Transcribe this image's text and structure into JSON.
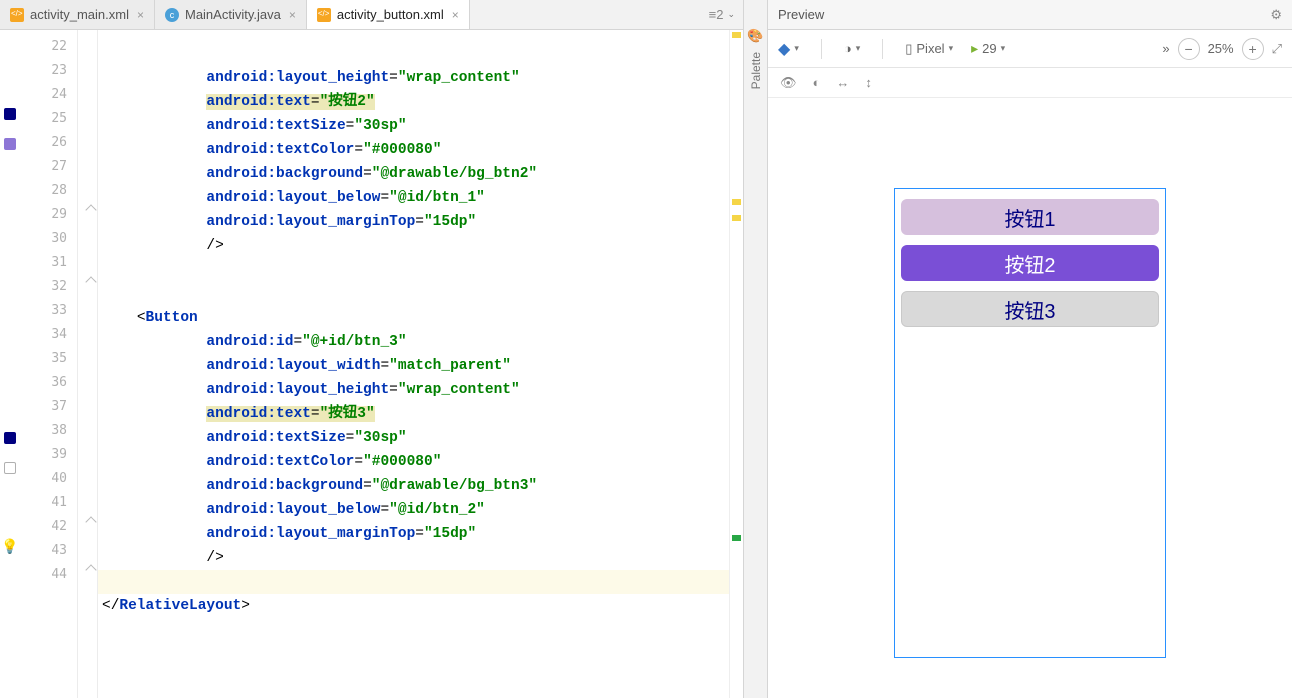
{
  "tabs": [
    {
      "label": "activity_main.xml",
      "icon": "xml-icon",
      "active": false,
      "closeable": true
    },
    {
      "label": "MainActivity.java",
      "icon": "java-icon",
      "active": false,
      "closeable": true
    },
    {
      "label": "activity_button.xml",
      "icon": "xml-icon",
      "active": true,
      "closeable": true
    }
  ],
  "tabbar_right_label": "≡2",
  "line_start": 22,
  "gutter_markers": {
    "25": "navy",
    "26": "purple",
    "38": "navy",
    "39": "outline",
    "42": "bulb"
  },
  "code": [
    {
      "n": 22,
      "indent": 12,
      "tokens": [
        [
          "attr",
          "android:"
        ],
        [
          "attr2",
          "layout_height"
        ],
        [
          "eq",
          "="
        ],
        [
          "val",
          "\"wrap_content\""
        ]
      ]
    },
    {
      "n": 23,
      "indent": 12,
      "hl": true,
      "tokens": [
        [
          "attr",
          "android:"
        ],
        [
          "attr2",
          "text"
        ],
        [
          "eq",
          "="
        ],
        [
          "val",
          "\"按钮2\""
        ]
      ]
    },
    {
      "n": 24,
      "indent": 12,
      "tokens": [
        [
          "attr",
          "android:"
        ],
        [
          "attr2",
          "textSize"
        ],
        [
          "eq",
          "="
        ],
        [
          "val",
          "\"30sp\""
        ]
      ]
    },
    {
      "n": 25,
      "indent": 12,
      "tokens": [
        [
          "attr",
          "android:"
        ],
        [
          "attr2",
          "textColor"
        ],
        [
          "eq",
          "="
        ],
        [
          "val",
          "\"#000080\""
        ]
      ]
    },
    {
      "n": 26,
      "indent": 12,
      "tokens": [
        [
          "attr",
          "android:"
        ],
        [
          "attr2",
          "background"
        ],
        [
          "eq",
          "="
        ],
        [
          "val",
          "\"@drawable/bg_btn2\""
        ]
      ]
    },
    {
      "n": 27,
      "indent": 12,
      "tokens": [
        [
          "attr",
          "android:"
        ],
        [
          "attr2",
          "layout_below"
        ],
        [
          "eq",
          "="
        ],
        [
          "val",
          "\"@id/btn_1\""
        ]
      ]
    },
    {
      "n": 28,
      "indent": 12,
      "tokens": [
        [
          "attr",
          "android:"
        ],
        [
          "attr2",
          "layout_marginTop"
        ],
        [
          "eq",
          "="
        ],
        [
          "val",
          "\"15dp\""
        ]
      ]
    },
    {
      "n": 29,
      "indent": 12,
      "fold": true,
      "tokens": [
        [
          "punct",
          "/>"
        ]
      ]
    },
    {
      "n": 30,
      "indent": 0,
      "tokens": []
    },
    {
      "n": 31,
      "indent": 0,
      "tokens": []
    },
    {
      "n": 32,
      "indent": 4,
      "foldopen": true,
      "tokens": [
        [
          "punct",
          "<"
        ],
        [
          "tag",
          "Button"
        ]
      ]
    },
    {
      "n": 33,
      "indent": 12,
      "tokens": [
        [
          "attr",
          "android:"
        ],
        [
          "attr2",
          "id"
        ],
        [
          "eq",
          "="
        ],
        [
          "val",
          "\"@+id/btn_3\""
        ]
      ]
    },
    {
      "n": 34,
      "indent": 12,
      "tokens": [
        [
          "attr",
          "android:"
        ],
        [
          "attr2",
          "layout_width"
        ],
        [
          "eq",
          "="
        ],
        [
          "val",
          "\"match_parent\""
        ]
      ]
    },
    {
      "n": 35,
      "indent": 12,
      "tokens": [
        [
          "attr",
          "android:"
        ],
        [
          "attr2",
          "layout_height"
        ],
        [
          "eq",
          "="
        ],
        [
          "val",
          "\"wrap_content\""
        ]
      ]
    },
    {
      "n": 36,
      "indent": 12,
      "hl": true,
      "tokens": [
        [
          "attr",
          "android:"
        ],
        [
          "attr2",
          "text"
        ],
        [
          "eq",
          "="
        ],
        [
          "val",
          "\"按钮3\""
        ]
      ]
    },
    {
      "n": 37,
      "indent": 12,
      "tokens": [
        [
          "attr",
          "android:"
        ],
        [
          "attr2",
          "textSize"
        ],
        [
          "eq",
          "="
        ],
        [
          "val",
          "\"30sp\""
        ]
      ]
    },
    {
      "n": 38,
      "indent": 12,
      "tokens": [
        [
          "attr",
          "android:"
        ],
        [
          "attr2",
          "textColor"
        ],
        [
          "eq",
          "="
        ],
        [
          "val",
          "\"#000080\""
        ]
      ]
    },
    {
      "n": 39,
      "indent": 12,
      "tokens": [
        [
          "attr",
          "android:"
        ],
        [
          "attr2",
          "background"
        ],
        [
          "eq",
          "="
        ],
        [
          "val",
          "\"@drawable/bg_btn3\""
        ]
      ]
    },
    {
      "n": 40,
      "indent": 12,
      "tokens": [
        [
          "attr",
          "android:"
        ],
        [
          "attr2",
          "layout_below"
        ],
        [
          "eq",
          "="
        ],
        [
          "val",
          "\"@id/btn_2\""
        ]
      ]
    },
    {
      "n": 41,
      "indent": 12,
      "tokens": [
        [
          "attr",
          "android:"
        ],
        [
          "attr2",
          "layout_marginTop"
        ],
        [
          "eq",
          "="
        ],
        [
          "val",
          "\"15dp\""
        ]
      ]
    },
    {
      "n": 42,
      "indent": 12,
      "fold": true,
      "tokens": [
        [
          "punct",
          "/>"
        ]
      ]
    },
    {
      "n": 43,
      "indent": 0,
      "cursor": true,
      "tokens": []
    },
    {
      "n": 44,
      "indent": 0,
      "fold": true,
      "tokens": [
        [
          "punct",
          "</"
        ],
        [
          "tag",
          "RelativeLayout"
        ],
        [
          "punct",
          ">"
        ]
      ]
    }
  ],
  "palette_label": "Palette",
  "palette_icon": "palette-icon",
  "preview": {
    "title": "Preview",
    "gear_icon": "gear-icon",
    "device_label": "Pixel",
    "api_label": "29",
    "zoom_pct": "25%",
    "more_icon": "»",
    "layers_icon": "layers-icon",
    "orient_icon": "orientation-icon",
    "phone_icon": "phone-icon",
    "android_icon": "android-icon",
    "eye_icon": "eye-icon",
    "colorblind_icon": "colorblind-icon",
    "harrow": "↔",
    "varrow": "↕",
    "buttons": [
      {
        "label": "按钮1",
        "cls": "btn1"
      },
      {
        "label": "按钮2",
        "cls": "btn2"
      },
      {
        "label": "按钮3",
        "cls": "btn3"
      }
    ]
  }
}
